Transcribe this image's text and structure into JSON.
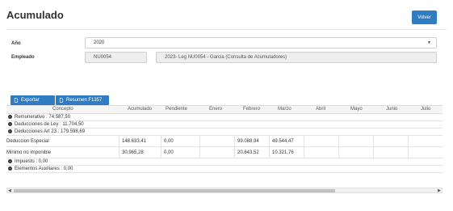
{
  "header": {
    "title": "Acumulado",
    "back_label": "Volver"
  },
  "form": {
    "year_label": "Año",
    "year_value": "2020",
    "employee_label": "Empleado",
    "employee_code": "NU0054",
    "employee_desc": "2023- Leg NU0054 - Garcia (Consulta de Acumuladores)"
  },
  "toolbar": {
    "export_label": "Exportar",
    "summary_label": "Resumen F1357"
  },
  "table": {
    "columns": [
      "Concepto",
      "Acumulado",
      "Pendiente",
      "Enero",
      "Febrero",
      "Marzo",
      "Abril",
      "Mayo",
      "Junio",
      "Julio"
    ],
    "groups": {
      "remunerativo": "Remunerativo : 74.587,50",
      "ded_ley": "Deducciones de Ley : 11.704,50",
      "ded_art23": "Deducciones Art 23 : 179.598,69",
      "impuesto": "Impuesto : 0,00",
      "elementos": "Elementos Auxiliares : 0,00"
    },
    "rows": [
      {
        "concepto": "Deduccion Especial",
        "acumulado": "148.633,41",
        "pendiente": "0,00",
        "enero": "",
        "febrero": "99.088,94",
        "marzo": "49.544,47",
        "abril": "",
        "mayo": "",
        "junio": "",
        "julio": ""
      },
      {
        "concepto": "Minimo no imponible",
        "acumulado": "30.965,28",
        "pendiente": "0,00",
        "enero": "",
        "febrero": "20.643,52",
        "marzo": "10.321,76",
        "abril": "",
        "mayo": "",
        "junio": "",
        "julio": ""
      }
    ]
  },
  "icons": {
    "group_toggle": "minus-circle-icon",
    "export": "file-icon",
    "summary": "file-icon"
  }
}
